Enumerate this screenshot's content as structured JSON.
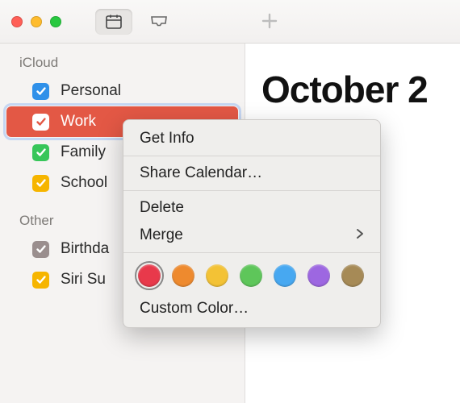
{
  "main": {
    "heading": "October 2"
  },
  "sidebar": {
    "sections": [
      {
        "title": "iCloud",
        "items": [
          {
            "label": "Personal",
            "color": "#2f90e9",
            "checked": true,
            "selected": false
          },
          {
            "label": "Work",
            "color": "#ffffff",
            "bg": "#e35845",
            "checked": true,
            "selected": true
          },
          {
            "label": "Family",
            "color": "#37c65a",
            "checked": true,
            "selected": false
          },
          {
            "label": "School",
            "color": "#f6b500",
            "checked": true,
            "selected": false
          }
        ]
      },
      {
        "title": "Other",
        "items": [
          {
            "label": "Birthda",
            "color": "#9a8e8e",
            "checked": true,
            "selected": false
          },
          {
            "label": "Siri Su",
            "color": "#f6b500",
            "checked": true,
            "selected": false
          }
        ]
      }
    ]
  },
  "context_menu": {
    "get_info": "Get Info",
    "share": "Share Calendar…",
    "delete": "Delete",
    "merge": "Merge",
    "custom_color": "Custom Color…",
    "colors": [
      {
        "hex": "#e8394b",
        "selected": true
      },
      {
        "hex": "#ee8a2e",
        "selected": false
      },
      {
        "hex": "#f3c235",
        "selected": false
      },
      {
        "hex": "#5ec65a",
        "selected": false
      },
      {
        "hex": "#47a8f1",
        "selected": false
      },
      {
        "hex": "#9d67e1",
        "selected": false
      },
      {
        "hex": "#a68a56",
        "selected": false
      }
    ]
  }
}
